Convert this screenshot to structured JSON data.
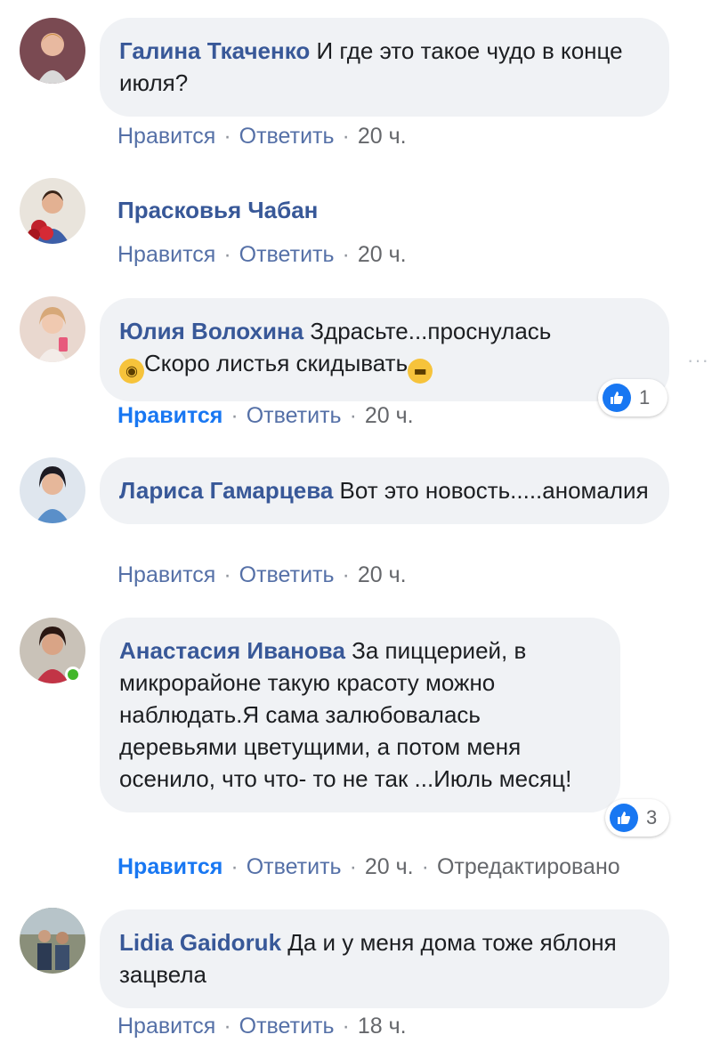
{
  "colors": {
    "bubble_bg": "#f0f2f5",
    "author": "#385898",
    "liked": "#1877f2",
    "meta": "#65676b",
    "online": "#42b72a"
  },
  "actions": {
    "like_label": "Нравится",
    "reply_label": "Ответить",
    "separator": "·",
    "edited_label": "Отредактировано"
  },
  "comments": [
    {
      "author": "Галина Ткаченко",
      "text": "И где это такое чудо в конце июля?",
      "time": "20 ч.",
      "avatar": "avatar-photo"
    },
    {
      "author": "Прасковья Чабан",
      "text": "",
      "time": "20 ч.",
      "avatar": "avatar-photo"
    },
    {
      "author": "Юлия Волохина",
      "text_part1": "Здрасьте...проснулась",
      "text_part2": "Скоро листья скидывать",
      "emoji1": "flushed-face-emoji",
      "emoji2": "grinning-face-emoji",
      "time": "20 ч.",
      "liked": true,
      "reactions": "1"
    },
    {
      "author": "Лариса Гамарцева",
      "text": "Вот это новость.....аномалия",
      "time": "20 ч."
    },
    {
      "author": "Анастасия Иванова",
      "text": "За пиццерией, в микрорайоне такую красоту можно наблюдать.Я сама залюбовалась деревьями цветущими, а потом меня осенило, что что- то не так ...Июль месяц!",
      "time": "20 ч.",
      "liked": true,
      "reactions": "3",
      "edited": true,
      "online": true
    },
    {
      "author": "Lidia Gaidoruk",
      "text": "Да и у меня дома тоже яблоня зацвела",
      "time": "18 ч."
    }
  ],
  "more_icon": "more-options-icon"
}
